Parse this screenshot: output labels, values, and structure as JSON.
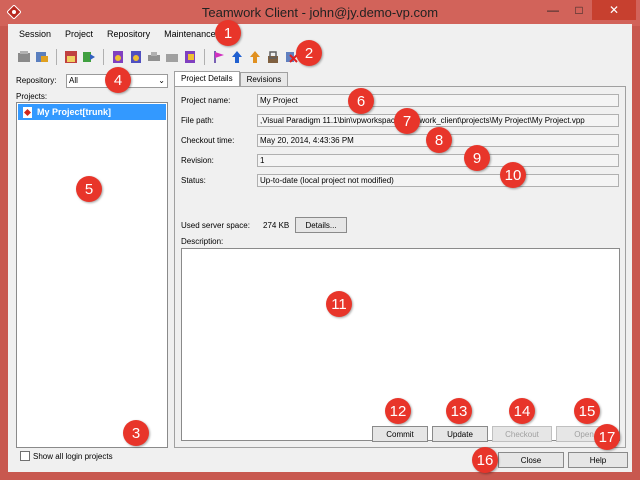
{
  "window": {
    "title": "Teamwork Client - john@jy.demo-vp.com"
  },
  "menu": [
    "Session",
    "Project",
    "Repository",
    "Maintenance"
  ],
  "toolbar": {
    "group1": [
      "open-session-icon",
      "edit-session-icon"
    ],
    "group2": [
      "manage-project-icon",
      "import-project-icon"
    ],
    "group3": [
      "commit-doc-icon",
      "update-doc-icon",
      "branch-icon",
      "merge-icon",
      "refresh-icon"
    ],
    "group4": [
      "flag-icon",
      "up-arrow-icon",
      "branch-up-icon",
      "lock-icon",
      "delete-icon"
    ]
  },
  "left": {
    "repo_label": "Repository:",
    "repo_value": "All",
    "projects_label": "Projects:",
    "project": "My Project[trunk]",
    "show_all_label": "Show all login projects",
    "show_all_checked": false
  },
  "tabs": {
    "details": "Project Details",
    "revisions": "Revisions"
  },
  "fields": {
    "project_name_label": "Project name:",
    "project_name": "My Project",
    "file_path_label": "File path:",
    "file_path": ",Visual Paradigm 11.1\\bin\\vpworkspace\\teamwork_client\\projects\\My Project\\My Project.vpp",
    "checkout_time_label": "Checkout time:",
    "checkout_time": "May 20, 2014, 4:43:36 PM",
    "revision_label": "Revision:",
    "revision": "1",
    "status_label": "Status:",
    "status": "Up-to-date (local project not modified)",
    "used_space_label": "Used server space:",
    "used_space": "274 KB",
    "details_button": "Details...",
    "description_label": "Description:"
  },
  "buttons": {
    "commit": "Commit",
    "update": "Update",
    "checkout": "Checkout",
    "open": "Open",
    "close": "Close",
    "help": "Help"
  },
  "callouts": [
    "1",
    "2",
    "3",
    "4",
    "5",
    "6",
    "7",
    "8",
    "9",
    "10",
    "11",
    "12",
    "13",
    "14",
    "15",
    "16",
    "17"
  ],
  "colors": {
    "title_bg": "#d2635a",
    "callout": "#e8352a",
    "selection": "#3399ff"
  }
}
